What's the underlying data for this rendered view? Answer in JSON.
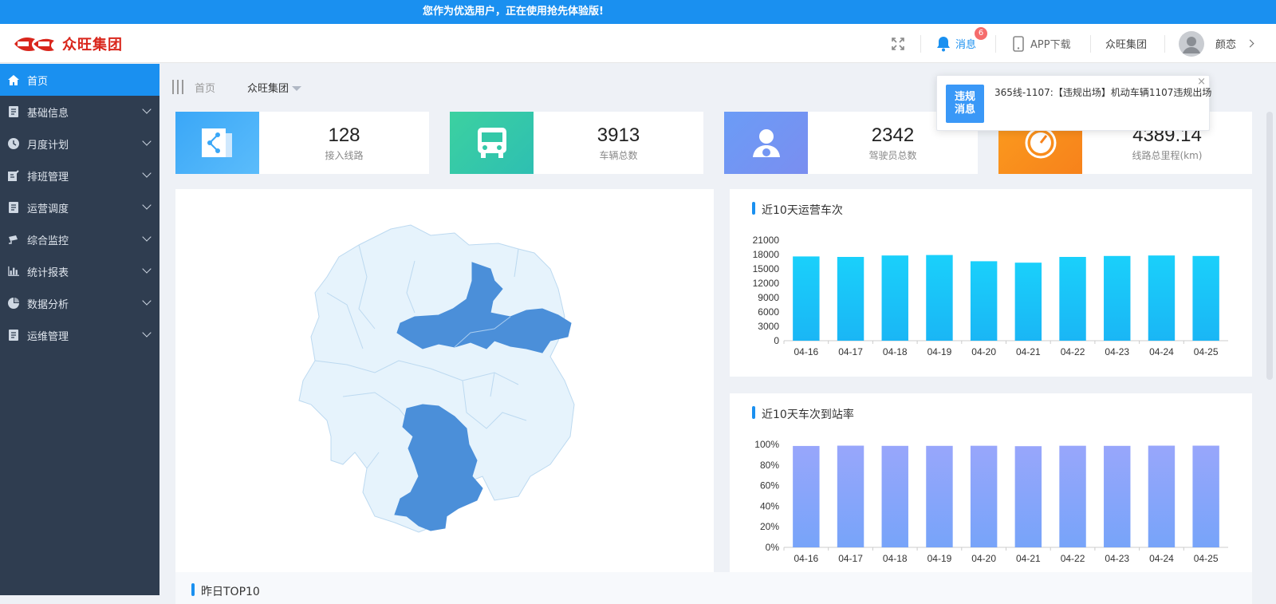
{
  "banner": {
    "text": "您作为优选用户，正在使用抢先体验版!"
  },
  "header": {
    "logo_mark": "众旺",
    "logo_text": "众旺集团",
    "icons": {
      "fullscreen": "fullscreen-icon",
      "bell": "bell-icon",
      "phone": "phone-icon",
      "avatar": "avatar-icon"
    },
    "messages_label": "消息",
    "messages_count": "6",
    "app_download_label": "APP下载",
    "org_label": "众旺集团",
    "user_name": "颜恋"
  },
  "sidebar": {
    "items": [
      {
        "label": "首页",
        "icon": "home-icon",
        "active": true
      },
      {
        "label": "基础信息",
        "icon": "doc-icon"
      },
      {
        "label": "月度计划",
        "icon": "clock-icon"
      },
      {
        "label": "排班管理",
        "icon": "edit-icon"
      },
      {
        "label": "运营调度",
        "icon": "doc-icon"
      },
      {
        "label": "综合监控",
        "icon": "camera-icon"
      },
      {
        "label": "统计报表",
        "icon": "bar-chart-icon"
      },
      {
        "label": "数据分析",
        "icon": "pie-chart-icon"
      },
      {
        "label": "运维管理",
        "icon": "doc-icon"
      }
    ]
  },
  "breadcrumb": {
    "home": "首页",
    "group": "众旺集团"
  },
  "stats": [
    {
      "value": "128",
      "label": "接入线路",
      "icon": "share-icon",
      "color_from": "#3aa7f7",
      "color_to": "#5bbcfb"
    },
    {
      "value": "3913",
      "label": "车辆总数",
      "icon": "bus-icon",
      "color_from": "#3cd1a0",
      "color_to": "#2ebfb2"
    },
    {
      "value": "2342",
      "label": "驾驶员总数",
      "icon": "driver-icon",
      "color_from": "#6b9cf6",
      "color_to": "#7a8ef0"
    },
    {
      "value": "4389.14",
      "label": "线路总里程(km)",
      "icon": "speedometer-icon",
      "color_from": "#fb9b1e",
      "color_to": "#f7821b"
    }
  ],
  "notice": {
    "tag_line1": "违规",
    "tag_line2": "消息",
    "message": "365线-1107:【违规出场】机动车辆1107违规出场",
    "close": "×"
  },
  "charts": {
    "trips": {
      "title": "近10天运营车次"
    },
    "arrival": {
      "title": "近10天车次到站率"
    }
  },
  "top10": {
    "title": "昨日TOP10"
  },
  "chart_data": [
    {
      "type": "bar",
      "title": "近10天运营车次",
      "categories": [
        "04-16",
        "04-17",
        "04-18",
        "04-19",
        "04-20",
        "04-21",
        "04-22",
        "04-23",
        "04-24",
        "04-25"
      ],
      "values": [
        17600,
        17500,
        17800,
        17900,
        16600,
        16300,
        17500,
        17700,
        17800,
        17700
      ],
      "yticks": [
        "0",
        "3000",
        "6000",
        "9000",
        "12000",
        "15000",
        "18000",
        "21000"
      ],
      "ylim": [
        0,
        21000
      ],
      "color_top": "#1ad0fb",
      "color_bottom": "#1ab6f5"
    },
    {
      "type": "bar",
      "title": "近10天车次到站率",
      "categories": [
        "04-16",
        "04-17",
        "04-18",
        "04-19",
        "04-20",
        "04-21",
        "04-22",
        "04-23",
        "04-24",
        "04-25"
      ],
      "values": [
        98.5,
        98.8,
        98.6,
        98.6,
        98.7,
        98.3,
        98.7,
        98.6,
        98.8,
        98.8
      ],
      "yticks": [
        "0%",
        "20%",
        "40%",
        "60%",
        "80%",
        "100%"
      ],
      "ylim": [
        0,
        100
      ],
      "color_top": "#98a6fb",
      "color_bottom": "#77a4f9"
    }
  ]
}
